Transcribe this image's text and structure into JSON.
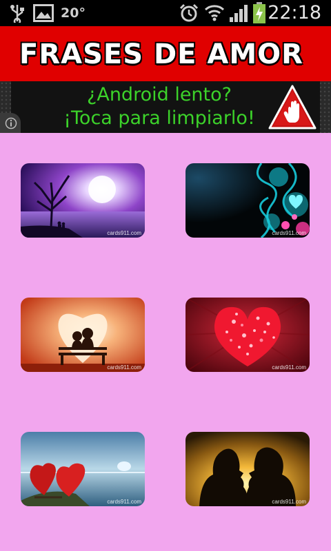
{
  "status_bar": {
    "temperature": "20°",
    "time": "22:18",
    "icons": [
      "usb-icon",
      "image-icon",
      "alarm-icon",
      "wifi-icon",
      "signal-icon",
      "battery-charging-icon"
    ]
  },
  "header": {
    "title": "FRASES DE AMOR",
    "background": "#e00000"
  },
  "ad_banner": {
    "line1": "¿Android lento?",
    "line2": "¡Toca para limpiarlo!",
    "text_color": "#3cd22a",
    "icons": [
      "warning-hand-icon",
      "info-icon"
    ]
  },
  "gallery": {
    "background": "#f2a6ee",
    "watermark": "cards911.com",
    "items": [
      {
        "name": "couple-tree-moon-card"
      },
      {
        "name": "blue-heart-swirl-card"
      },
      {
        "name": "couple-bench-sunset-card"
      },
      {
        "name": "red-heart-particles-card"
      },
      {
        "name": "two-hearts-seaside-card"
      },
      {
        "name": "couple-kiss-silhouette-card"
      }
    ]
  }
}
